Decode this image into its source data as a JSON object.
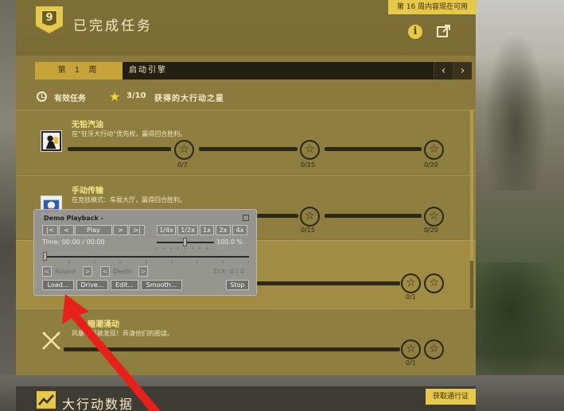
{
  "header": {
    "level": "9",
    "title": "已完成任务",
    "notice": "第 16 周内容现在可用"
  },
  "week_bar": {
    "week_label": "第 1 周",
    "week_name": "启动引擎",
    "prev": "‹",
    "next": "›"
  },
  "status": {
    "label": "有效任务",
    "count": "3/10",
    "text": "获得的大行动之星"
  },
  "missions": [
    {
      "title": "无铅汽油",
      "desc": "在“狂牙大行动”优先权，赢得回合胜利。",
      "progress": [
        "0/7",
        "0/15",
        "0/20"
      ]
    },
    {
      "title": "手动传输",
      "desc": "在竞技模式：车展大厅，赢得回合胜利。",
      "progress": [
        "0/15",
        "0/20"
      ]
    },
    {
      "progress": [
        "0/1"
      ]
    },
    {
      "title_partial": "暗潮涌动",
      "desc": "风暴十已被发现！弄清他们的图谋。",
      "progress": [
        "0/1"
      ]
    }
  ],
  "bottom": {
    "title": "大行动数据",
    "pass_button": "获取通行证"
  },
  "demo_playback": {
    "title": "Demo Playback -",
    "buttons": {
      "go_start": "|<",
      "back": "<",
      "play": "Play",
      "forward": ">",
      "go_end": ">|",
      "speed_quarter": "1/4x",
      "speed_half": "1/2x",
      "speed_1x": "1x",
      "speed_2x": "2x",
      "speed_4x": "4x",
      "round_prev": "<",
      "round_next": ">",
      "death_prev": "<",
      "death_next": ">",
      "load": "Load...",
      "drive": "Drive...",
      "edit": "Edit...",
      "smooth": "Smooth...",
      "stop": "Stop"
    },
    "time": "Time: 00:00 / 00:00",
    "speed_percent": "100.0 %",
    "round_label": "Round",
    "death_label": "Death",
    "tick": "Tick: 0 / 0",
    "speed_level": 0.5
  },
  "colors": {
    "accent": "#e6c84c",
    "arrow": "#e8201a"
  }
}
